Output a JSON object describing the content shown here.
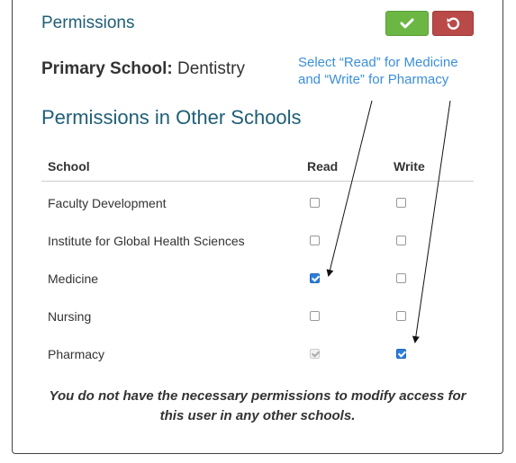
{
  "header": {
    "title": "Permissions"
  },
  "actions": {
    "save_icon": "checkmark-icon",
    "cancel_icon": "undo-icon",
    "save_color": "#6cb744",
    "cancel_color": "#b94a48"
  },
  "primary": {
    "label": "Primary School:",
    "value": "Dentistry"
  },
  "annotation": {
    "text": "Select “Read” for Medicine and “Write” for Pharmacy"
  },
  "other": {
    "title": "Permissions in Other Schools"
  },
  "table": {
    "columns": [
      "School",
      "Read",
      "Write"
    ],
    "rows": [
      {
        "school": "Faculty Development",
        "read": false,
        "write": false
      },
      {
        "school": "Institute for Global Health Sciences",
        "read": false,
        "write": false
      },
      {
        "school": "Medicine",
        "read": true,
        "write": false
      },
      {
        "school": "Nursing",
        "read": false,
        "write": false
      },
      {
        "school": "Pharmacy",
        "read": "disabled-checked",
        "write": true
      }
    ]
  },
  "notice": {
    "text": "You do not have the necessary permissions to modify access for this user in any other schools."
  }
}
